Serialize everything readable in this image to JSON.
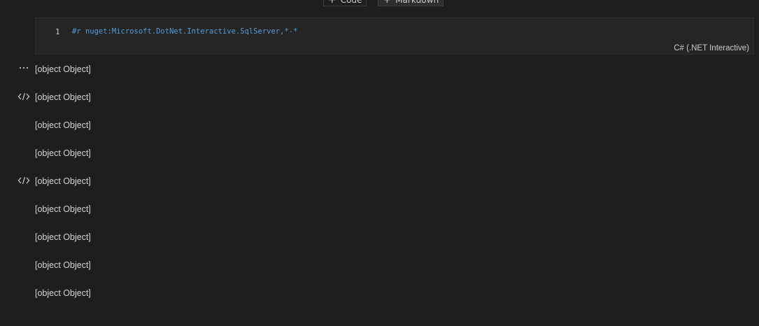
{
  "toolbar": {
    "code_label": "Code",
    "markdown_label": "Markdown"
  },
  "cell": {
    "line_number": "1",
    "code": "#r nuget:Microsoft.DotNet.Interactive.SqlServer,*-*",
    "language": "C# (.NET Interactive)"
  },
  "outputs": [
    {
      "icon": "ellipsis-icon",
      "text": "[object Object]"
    },
    {
      "icon": "code-icon",
      "text": "[object Object]"
    },
    {
      "icon": "",
      "text": "[object Object]"
    },
    {
      "icon": "",
      "text": "[object Object]"
    },
    {
      "icon": "code-icon",
      "text": "[object Object]"
    },
    {
      "icon": "",
      "text": "[object Object]"
    },
    {
      "icon": "",
      "text": "[object Object]"
    },
    {
      "icon": "",
      "text": "[object Object]"
    },
    {
      "icon": "",
      "text": "[object Object]"
    }
  ],
  "colors": {
    "background": "#1e1e1e",
    "cell_background": "#252526",
    "code_keyword": "#569cd6"
  }
}
